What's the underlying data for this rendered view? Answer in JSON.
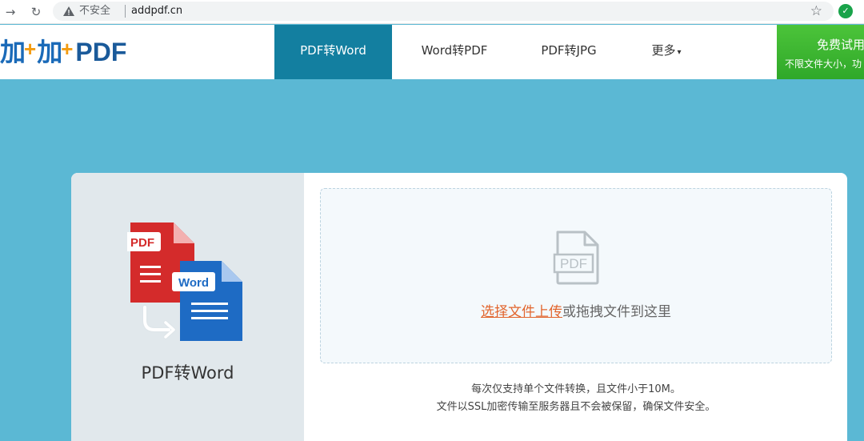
{
  "browser": {
    "security_text": "不安全",
    "url": "addpdf.cn",
    "icons": [
      "forward-icon",
      "reload-icon",
      "warning-icon",
      "bookmark-star-icon",
      "extension-icon"
    ]
  },
  "header": {
    "logo": {
      "part1": "加",
      "part2": "加",
      "part3": "PDF"
    },
    "nav": [
      {
        "label": "PDF转Word",
        "active": true
      },
      {
        "label": "Word转PDF",
        "active": false
      },
      {
        "label": "PDF转JPG",
        "active": false
      },
      {
        "label": "更多",
        "active": false
      }
    ],
    "trial": {
      "title": "免费试用",
      "subtitle": "不限文件大小，功"
    }
  },
  "converter": {
    "tool_name": "PDF转Word",
    "illustration": {
      "pdf_label": "PDF",
      "word_label": "Word"
    },
    "upload": {
      "file_icon_label": "PDF",
      "link_text": "选择文件上传",
      "drag_text": "或拖拽文件到这里"
    },
    "notes": [
      "每次仅支持单个文件转换，且文件小于10M。",
      "文件以SSL加密传输至服务器且不会被保留，确保文件安全。"
    ]
  },
  "colors": {
    "page_bg": "#5bb8d4",
    "nav_active": "#137fa0",
    "trial_green": "#2fa829",
    "upload_link": "#e2652d",
    "pdf_red": "#d42b2b",
    "word_blue": "#1e6bc4"
  }
}
